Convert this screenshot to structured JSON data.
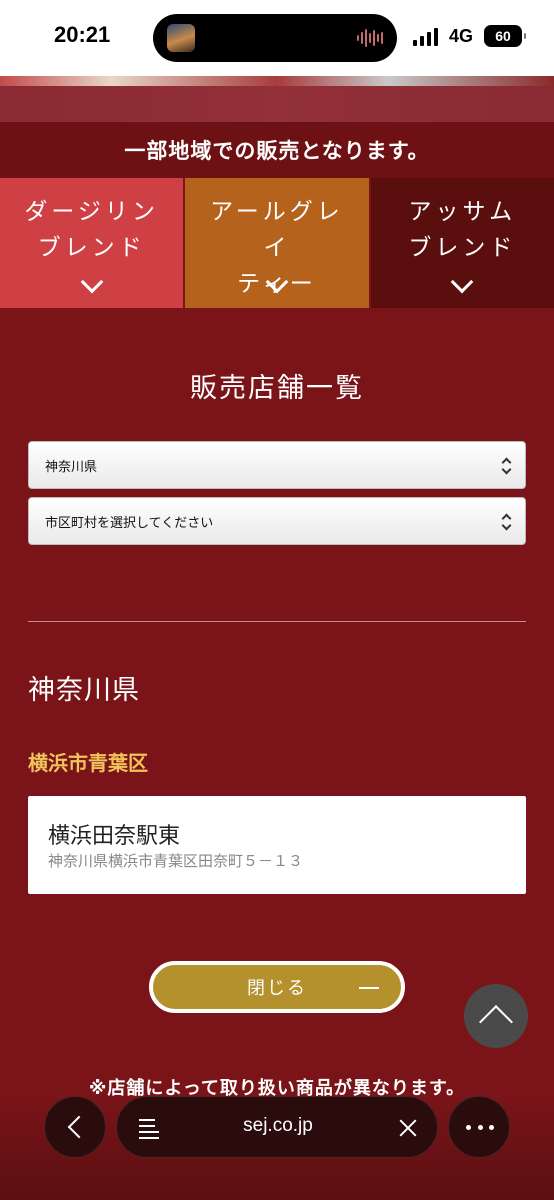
{
  "status_bar": {
    "time": "20:21",
    "network": "4G",
    "battery": "60"
  },
  "notice": "一部地域での販売となります。",
  "tabs": [
    {
      "label": "ダージリン\nブレンド"
    },
    {
      "label": "アールグレイ\nティー"
    },
    {
      "label": "アッサム\nブレンド"
    }
  ],
  "store_list": {
    "title": "販売店舗一覧",
    "prefecture_select": "神奈川県",
    "city_select": "市区町村を選択してください",
    "prefecture_heading": "神奈川県",
    "ward_heading": "横浜市青葉区",
    "stores": [
      {
        "name": "横浜田奈駅東",
        "address": "神奈川県横浜市青葉区田奈町５－１３"
      }
    ],
    "close_label": "閉じる"
  },
  "disclaimer": "※店舗によって取り扱い商品が異なります。",
  "browser": {
    "url": "sej.co.jp"
  },
  "colors": {
    "background": "#7a1418",
    "tab_darjeeling": "#cf4045",
    "tab_earl_grey": "#b5621d",
    "tab_assam": "#5a0e0e",
    "ward_heading": "#f0c45a",
    "close_button": "#b4912d"
  }
}
